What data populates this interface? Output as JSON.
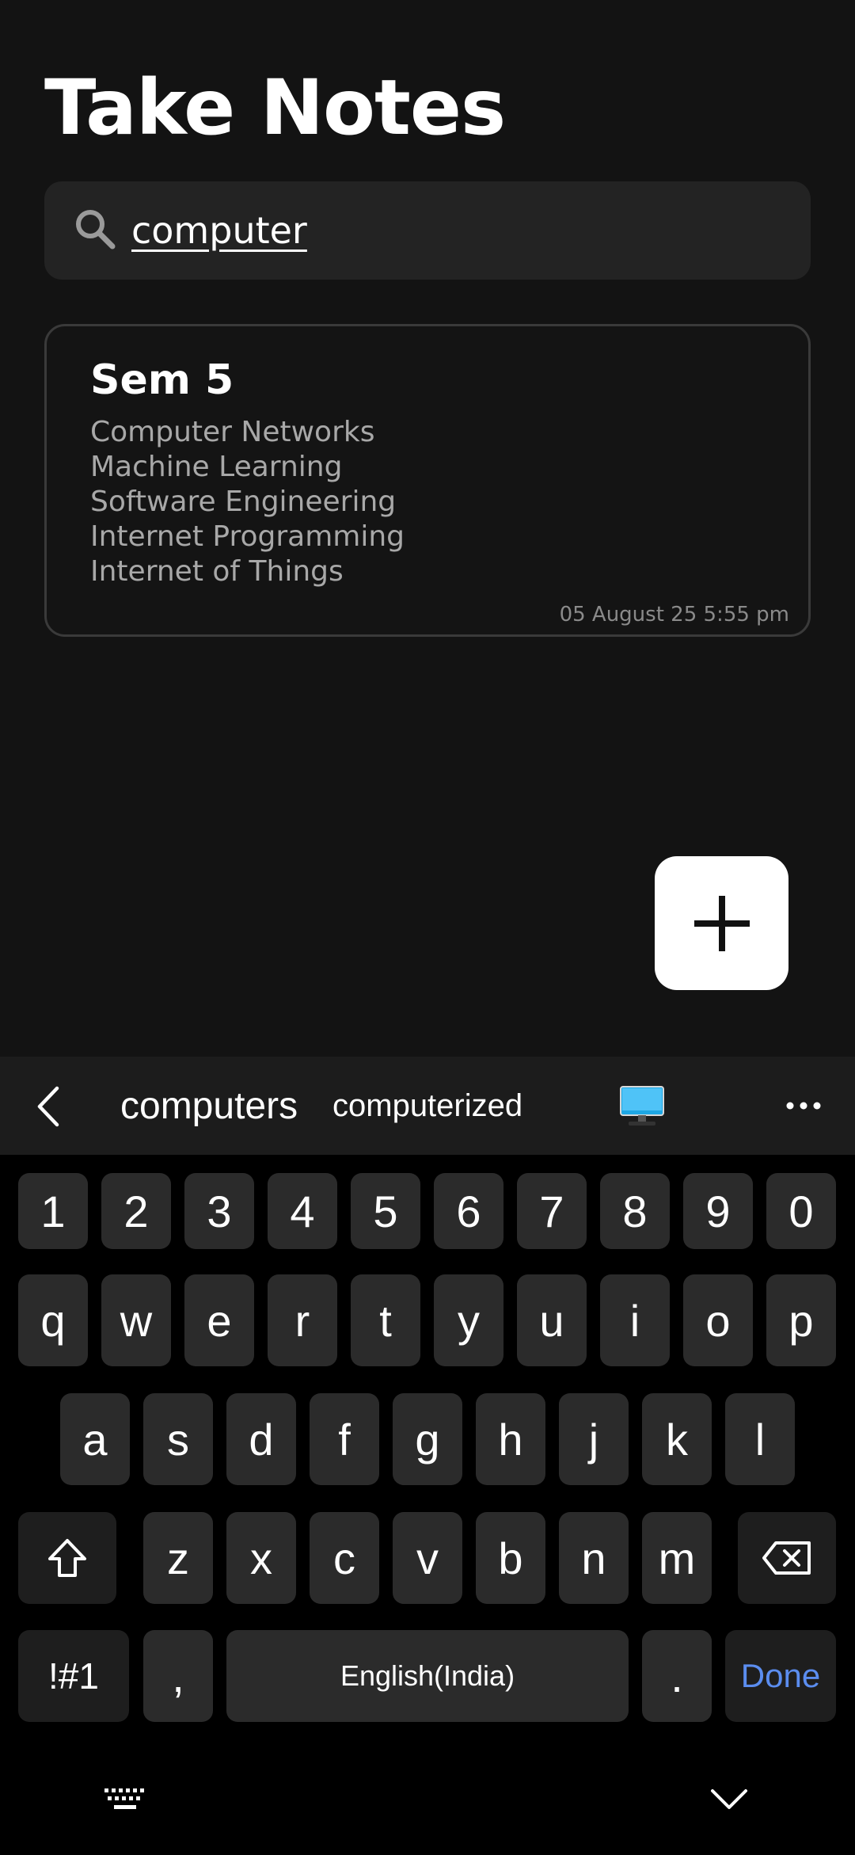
{
  "app": {
    "title": "Take Notes"
  },
  "search": {
    "value": "computer",
    "icon": "search-icon"
  },
  "notes": [
    {
      "title": "Sem 5",
      "lines": [
        "Computer Networks",
        "Machine Learning",
        "Software Engineering",
        "Internet Programming",
        "Internet of Things"
      ],
      "timestamp": "05 August 25  5:55 pm"
    }
  ],
  "fab": {
    "icon": "plus-icon"
  },
  "suggestions": {
    "words": [
      "computers",
      "computerized"
    ],
    "emoji": "desktop-computer-emoji",
    "back_icon": "chevron-left-icon",
    "more_icon": "more-horizontal-icon"
  },
  "keyboard": {
    "row_numbers": [
      "1",
      "2",
      "3",
      "4",
      "5",
      "6",
      "7",
      "8",
      "9",
      "0"
    ],
    "row_top": [
      "q",
      "w",
      "e",
      "r",
      "t",
      "y",
      "u",
      "i",
      "o",
      "p"
    ],
    "row_home": [
      "a",
      "s",
      "d",
      "f",
      "g",
      "h",
      "j",
      "k",
      "l"
    ],
    "row_bottom": [
      "z",
      "x",
      "c",
      "v",
      "b",
      "n",
      "m"
    ],
    "symbols_label": "!#1",
    "comma_label": ",",
    "space_label": "English(India)",
    "period_label": ".",
    "done_label": "Done",
    "shift_icon": "shift-icon",
    "backspace_icon": "backspace-icon"
  },
  "nav": {
    "keyboard_icon": "keyboard-icon",
    "hide_icon": "chevron-down-icon"
  },
  "colors": {
    "background": "#131313",
    "accent": "#5b8def",
    "card_border": "#3a3a3a"
  }
}
